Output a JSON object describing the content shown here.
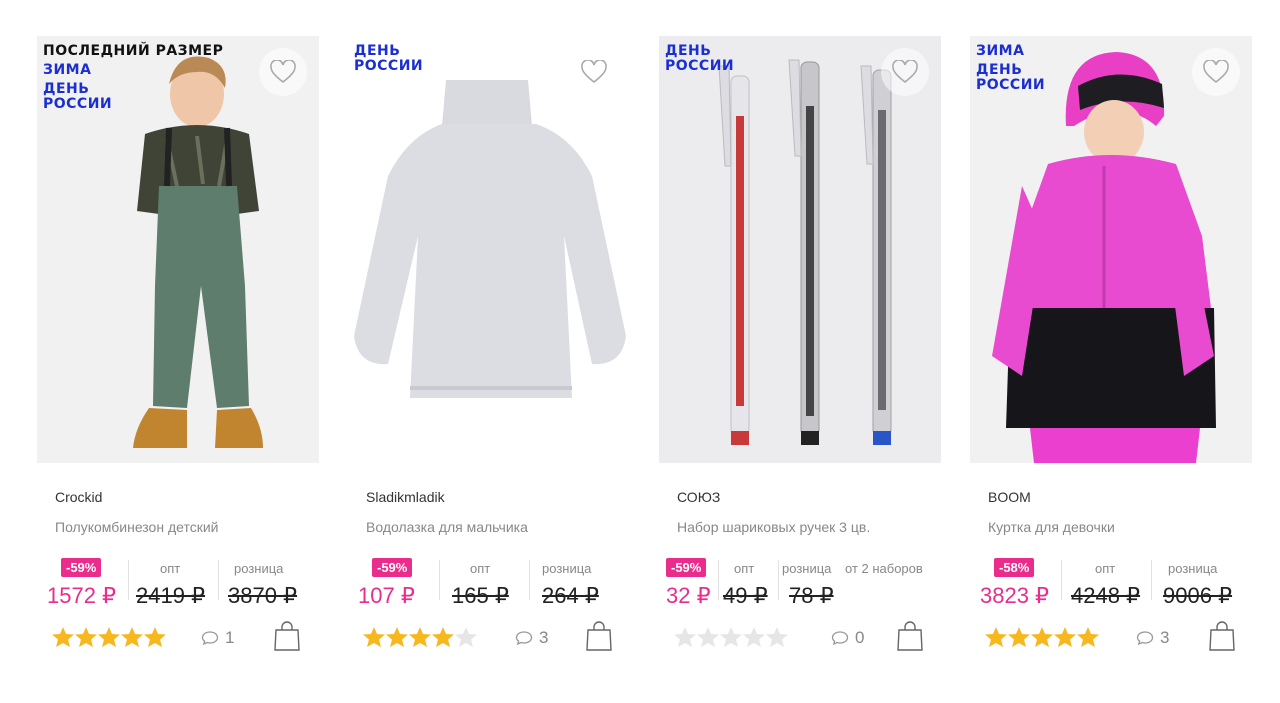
{
  "colors": {
    "accent": "#ea2d8d",
    "badge_blue": "#1b2fd0",
    "star_on": "#f6b81e",
    "star_off": "#e6e6e6"
  },
  "products": [
    {
      "badges": [
        "ПОСЛЕДНИЙ РАЗМЕР",
        "ЗИМА",
        "ДЕНЬ\nРОССИИ"
      ],
      "brand": "Crockid",
      "name": "Полукомбинезон детский",
      "discount": "-59%",
      "price": "1572 ₽",
      "opt_label": "опт",
      "opt_price": "2419 ₽",
      "retail_label": "розница",
      "retail_price": "3870 ₽",
      "rating": 5,
      "comments": "1",
      "image": "boy-in-green-snow-overalls"
    },
    {
      "badges": [
        "ДЕНЬ\nРОССИИ"
      ],
      "brand": "Sladikmladik",
      "name": "Водолазка для мальчика",
      "discount": "-59%",
      "price": "107 ₽",
      "opt_label": "опт",
      "opt_price": "165 ₽",
      "retail_label": "розница",
      "retail_price": "264 ₽",
      "rating": 4,
      "comments": "3",
      "image": "light-grey-turtleneck"
    },
    {
      "badges": [
        "ДЕНЬ\nРОССИИ"
      ],
      "brand": "СОЮЗ",
      "name": "Набор шариковых ручек 3 цв.",
      "discount": "-59%",
      "price": "32 ₽",
      "opt_label": "опт",
      "opt_price": "49 ₽",
      "retail_label": "розница",
      "retail_extra": "от 2 наборов",
      "retail_price": "78 ₽",
      "rating": 0,
      "comments": "0",
      "image": "three-ballpoint-pens"
    },
    {
      "badges": [
        "ЗИМА",
        "ДЕНЬ\nРОССИИ"
      ],
      "brand": "BOOM",
      "name": "Куртка для девочки",
      "discount": "-58%",
      "price": "3823 ₽",
      "opt_label": "опт",
      "opt_price": "4248 ₽",
      "retail_label": "розница",
      "retail_price": "9006 ₽",
      "rating": 5,
      "comments": "3",
      "image": "girl-in-pink-ski-jacket"
    }
  ]
}
